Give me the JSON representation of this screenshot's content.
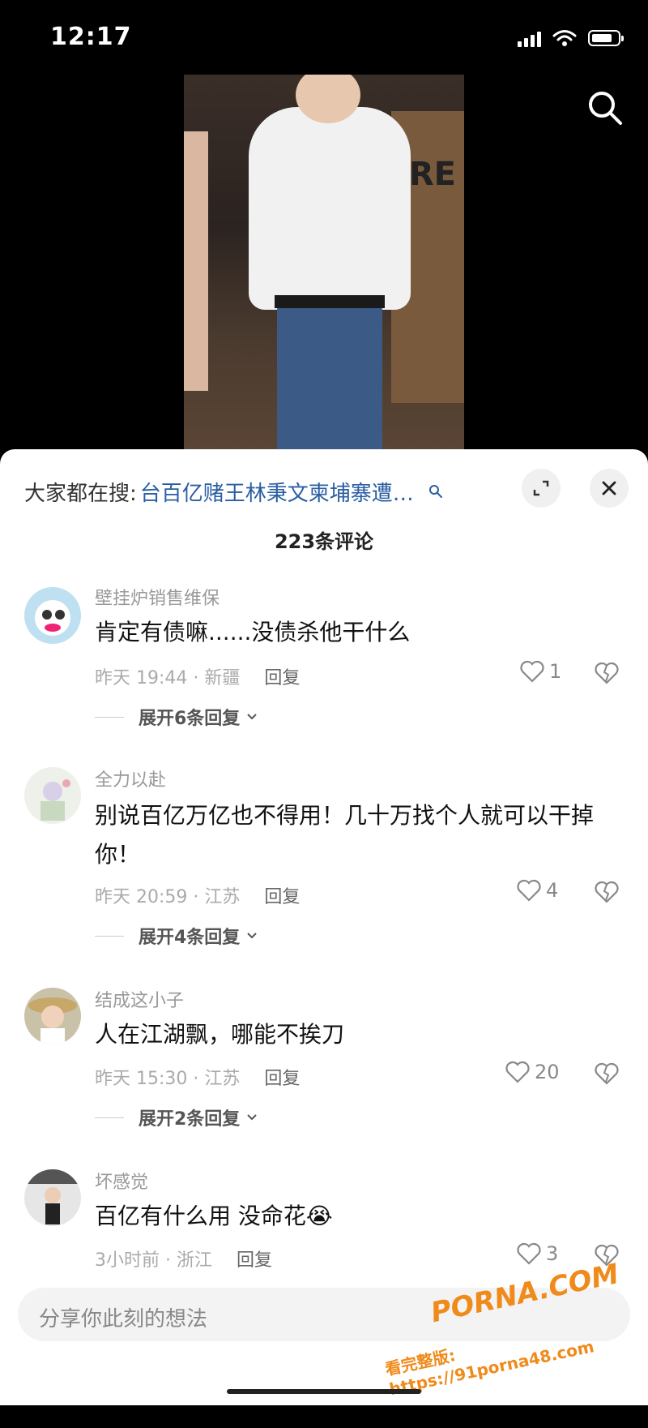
{
  "status": {
    "time": "12:17"
  },
  "trending": {
    "prefix": "大家都在搜:",
    "query": "台百亿赌王林秉文柬埔寨遭…"
  },
  "comment_count": "223条评论",
  "comments": [
    {
      "user": "壁挂炉销售维保",
      "text": "肯定有债嘛......没债杀他干什么",
      "time": "昨天 19:44 · 新疆",
      "reply": "回复",
      "likes": "1",
      "expand": "展开6条回复"
    },
    {
      "user": "全力以赴",
      "text": "别说百亿万亿也不得用！几十万找个人就可以干掉你！",
      "time": "昨天 20:59 · 江苏",
      "reply": "回复",
      "likes": "4",
      "expand": "展开4条回复"
    },
    {
      "user": "结成这小子",
      "text": "人在江湖飘，哪能不挨刀",
      "time": "昨天 15:30 · 江苏",
      "reply": "回复",
      "likes": "20",
      "expand": "展开2条回复"
    },
    {
      "user": "坏感觉",
      "text": "百亿有什么用 没命花😭",
      "time": "3小时前 · 浙江",
      "reply": "回复",
      "likes": "3"
    }
  ],
  "input": {
    "placeholder": "分享你此刻的想法"
  },
  "watermark": {
    "logo": "PORNA.COM",
    "url": "看完整版: https://91porna48.com"
  },
  "colors": {
    "link": "#2a5ea3",
    "watermark": "#f08a1a"
  }
}
